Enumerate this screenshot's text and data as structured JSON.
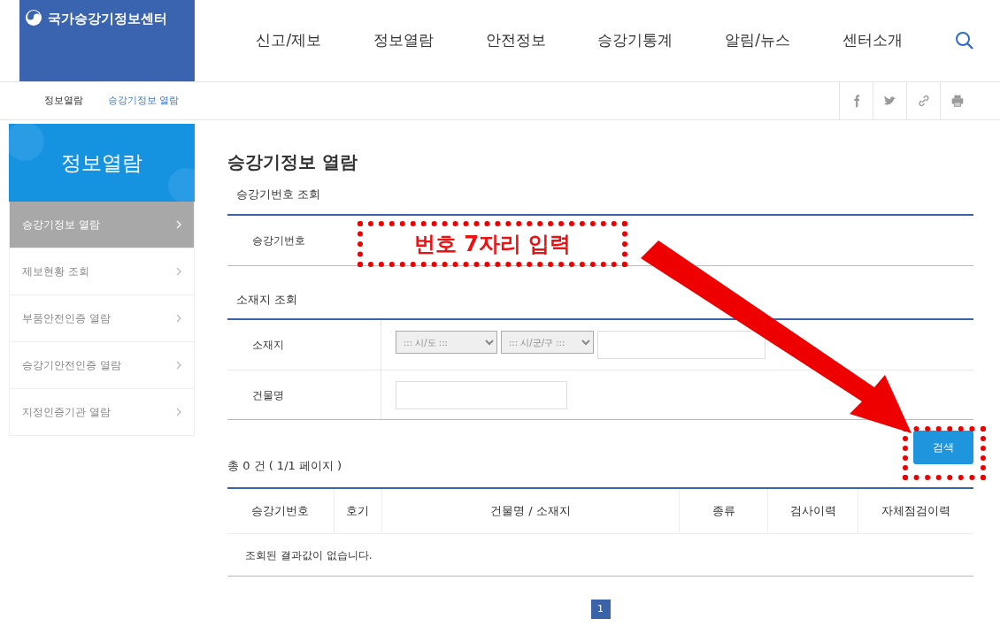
{
  "logo": {
    "title": "국가승강기정보센터"
  },
  "nav": [
    {
      "label": "신고/제보"
    },
    {
      "label": "정보열람"
    },
    {
      "label": "안전정보"
    },
    {
      "label": "승강기통계"
    },
    {
      "label": "알림/뉴스"
    },
    {
      "label": "센터소개"
    }
  ],
  "breadcrumb": [
    "정보열람",
    "승강기정보 열람"
  ],
  "sidebar": {
    "title": "정보열람",
    "items": [
      {
        "label": "승강기정보 열람",
        "selected": true
      },
      {
        "label": "제보현황 조회",
        "selected": false
      },
      {
        "label": "부품안전인증 열람",
        "selected": false
      },
      {
        "label": "승강기안전인증 열람",
        "selected": false
      },
      {
        "label": "지정인증기관 열람",
        "selected": false
      }
    ]
  },
  "page_title": "승강기정보 열람",
  "number_search": {
    "heading": "승강기번호 조회",
    "label": "승강기번호"
  },
  "location_search": {
    "heading": "소재지 조회",
    "location_label": "소재지",
    "province": "::: 시/도 :::",
    "district": "::: 시/군/구 :::",
    "building_label": "건물명"
  },
  "search_button": "검색",
  "summary": "총 0 건 ( 1/1 페이지 )",
  "table": {
    "columns": [
      "승강기번호",
      "호기",
      "건물명 / 소재지",
      "종류",
      "검사이력",
      "자체점검이력"
    ],
    "empty_message": "조회된 결과값이 없습니다."
  },
  "pagination": [
    {
      "label": "1",
      "selected": true
    }
  ],
  "annotation": {
    "text": "번호 7자리 입력"
  }
}
